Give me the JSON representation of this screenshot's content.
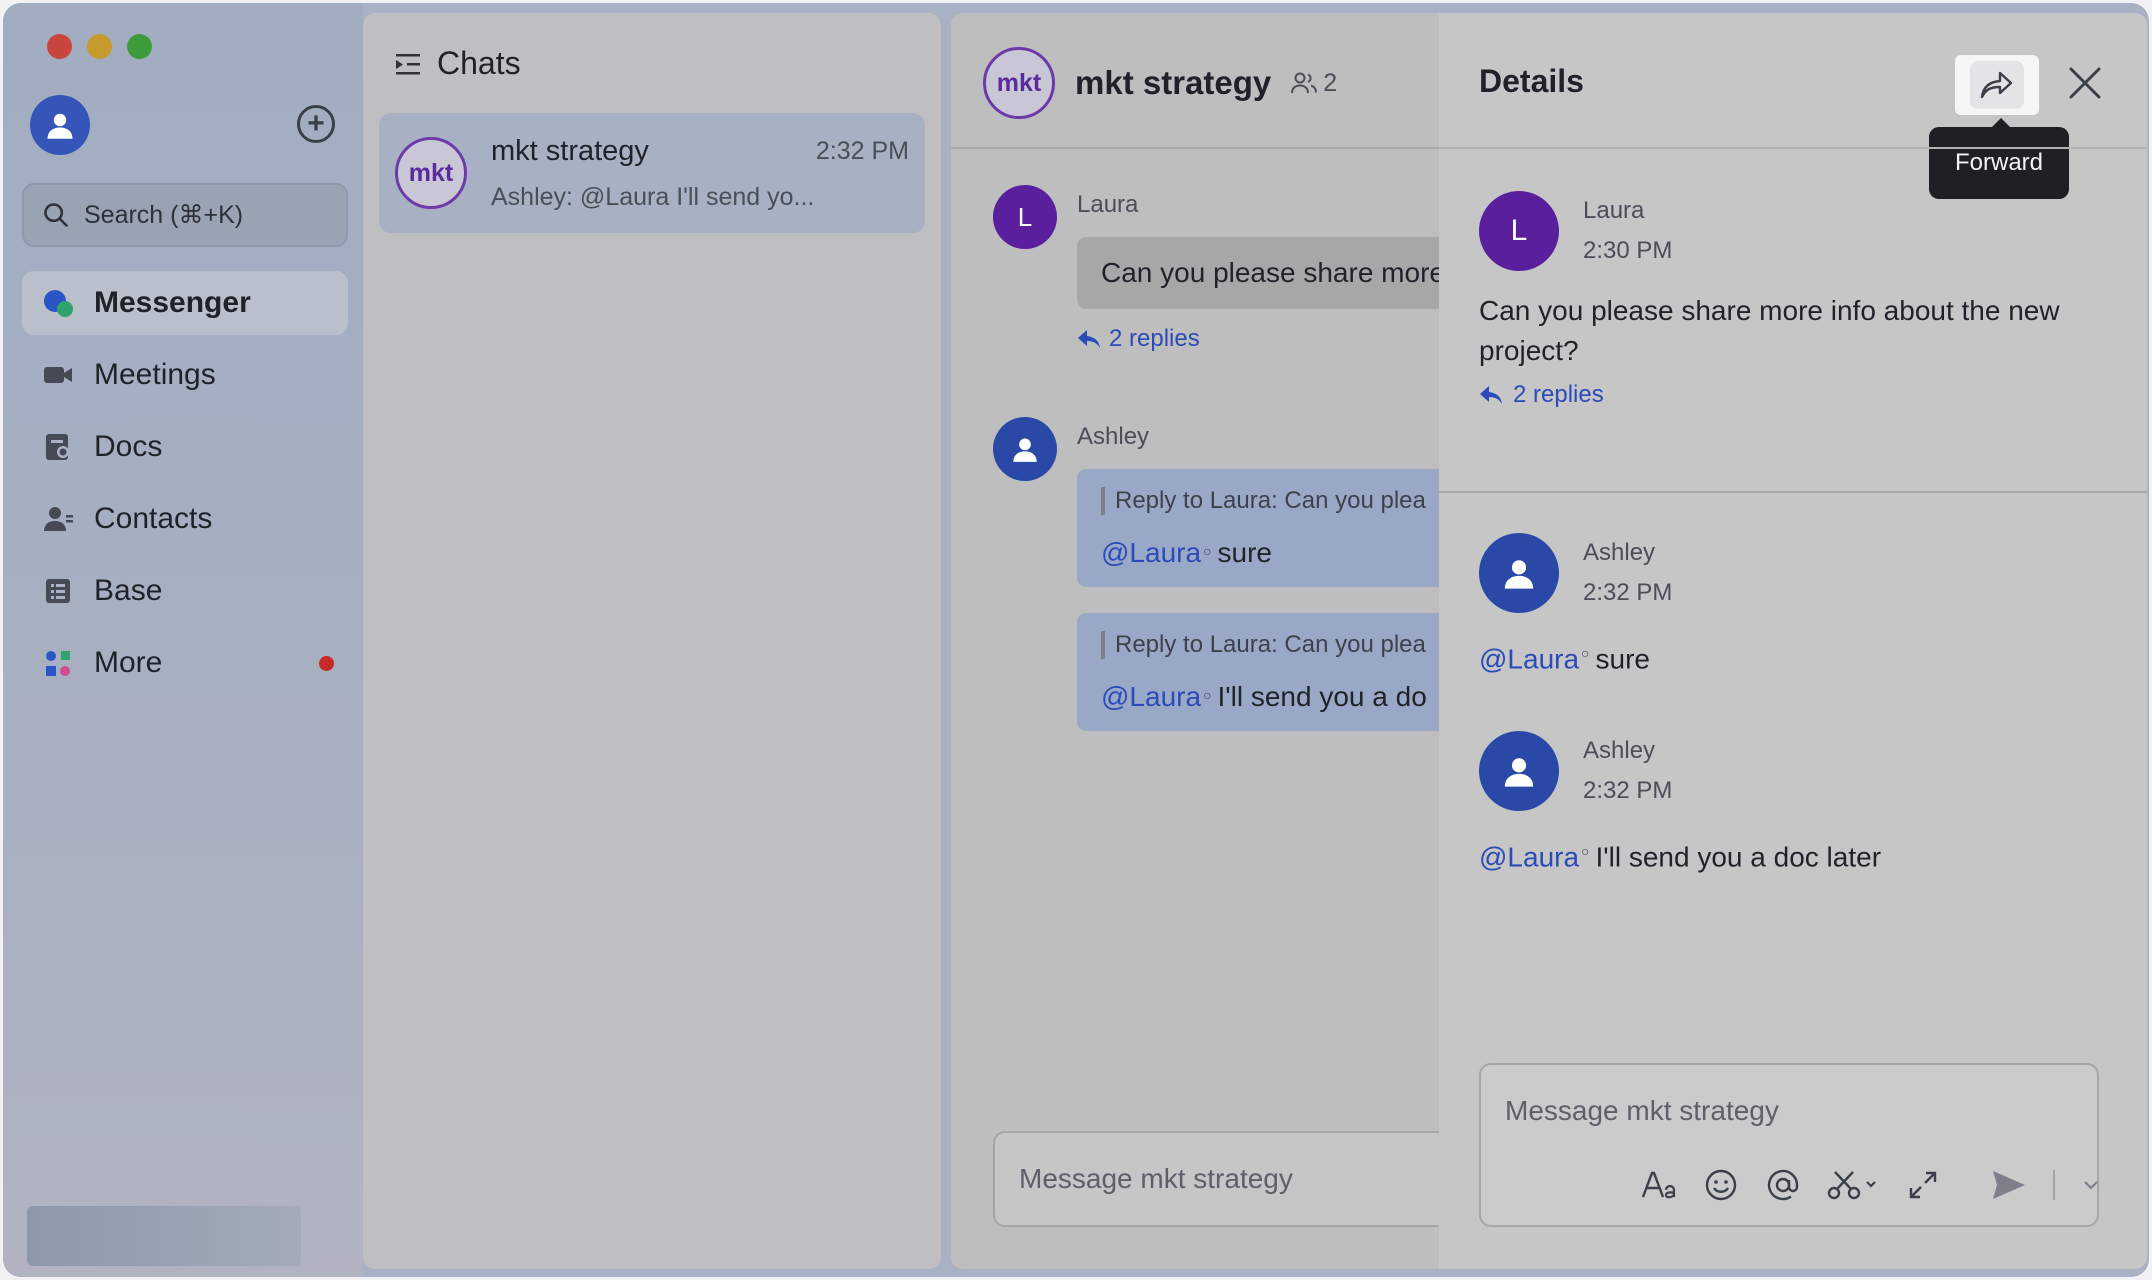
{
  "window": {
    "controls": [
      "close",
      "minimize",
      "zoom"
    ]
  },
  "sidebar": {
    "search_placeholder": "Search (⌘+K)",
    "items": [
      {
        "label": "Messenger",
        "icon": "messenger-icon",
        "active": true
      },
      {
        "label": "Meetings",
        "icon": "video-camera-icon"
      },
      {
        "label": "Docs",
        "icon": "docs-icon"
      },
      {
        "label": "Contacts",
        "icon": "contacts-icon"
      },
      {
        "label": "Base",
        "icon": "base-icon"
      },
      {
        "label": "More",
        "icon": "more-apps-icon",
        "badge": "red-dot"
      }
    ]
  },
  "chatlist": {
    "title": "Chats",
    "chats": [
      {
        "avatar": "mkt",
        "name": "mkt strategy",
        "time": "2:32 PM",
        "preview": "Ashley: @Laura I'll send yo..."
      }
    ]
  },
  "main": {
    "avatar": "mkt",
    "title": "mkt strategy",
    "member_count": "2",
    "messages": [
      {
        "sender": "Laura",
        "initial": "L",
        "text": "Can you please share more",
        "replies": "2 replies"
      },
      {
        "sender": "Ashley",
        "replies": [
          {
            "reply_to": "Reply to Laura:  Can you plea",
            "mention": "@Laura",
            "text": "sure"
          },
          {
            "reply_to": "Reply to Laura:  Can you plea",
            "mention": "@Laura",
            "text": "I'll send you a do"
          }
        ]
      }
    ],
    "input_placeholder": "Message mkt strategy"
  },
  "details": {
    "title": "Details",
    "tooltip": "Forward",
    "root": {
      "sender": "Laura",
      "initial": "L",
      "time": "2:30 PM",
      "text": "Can you please share more info about the new project?",
      "replies": "2 replies"
    },
    "replies": [
      {
        "sender": "Ashley",
        "time": "2:32 PM",
        "mention": "@Laura",
        "text": "sure"
      },
      {
        "sender": "Ashley",
        "time": "2:32 PM",
        "mention": "@Laura",
        "text": "I'll send you a doc later"
      }
    ],
    "input_placeholder": "Message mkt strategy",
    "toolbar": [
      "text-format-icon",
      "emoji-icon",
      "mention-icon",
      "scissors-icon",
      "expand-icon",
      "send-icon",
      "chevron-down-icon"
    ]
  },
  "colors": {
    "accent_blue": "#2a4bb8",
    "avatar_purple": "#5a1f9c",
    "avatar_blue": "#2a49a6",
    "badge_red": "#c42b2b"
  }
}
